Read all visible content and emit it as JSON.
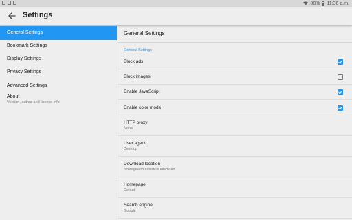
{
  "status_bar": {
    "battery": "88%",
    "time": "11:36 a.m.",
    "icons": [
      "image-icon",
      "download-icon",
      "notification-icon",
      "wifi-icon",
      "battery-icon"
    ]
  },
  "app_bar": {
    "back_icon": "back-arrow-icon",
    "title": "Settings"
  },
  "sidebar": {
    "items": [
      {
        "label": "General Settings",
        "active": true
      },
      {
        "label": "Bookmark Settings",
        "active": false
      },
      {
        "label": "Display Settings",
        "active": false
      },
      {
        "label": "Privacy Settings",
        "active": false
      },
      {
        "label": "Advanced Settings",
        "active": false
      }
    ],
    "about": {
      "title": "About",
      "subtitle": "Version, author and license info."
    }
  },
  "content": {
    "header": "General Settings",
    "category": "General Settings",
    "toggles": [
      {
        "label": "Block ads",
        "checked": true
      },
      {
        "label": "Block images",
        "checked": false
      },
      {
        "label": "Enable JavaScript",
        "checked": true
      },
      {
        "label": "Enable color mode",
        "checked": true
      }
    ],
    "preferences": [
      {
        "title": "HTTP proxy",
        "value": "None"
      },
      {
        "title": "User agent",
        "value": "Desktop"
      },
      {
        "title": "Download location",
        "value": "/storage/emulated/0/Download"
      },
      {
        "title": "Homepage",
        "value": "Default"
      },
      {
        "title": "Search engine",
        "value": "Google"
      }
    ]
  },
  "colors": {
    "accent": "#2196f3",
    "background": "#eeeeee",
    "text_primary": "#212121",
    "text_secondary": "#757575"
  }
}
